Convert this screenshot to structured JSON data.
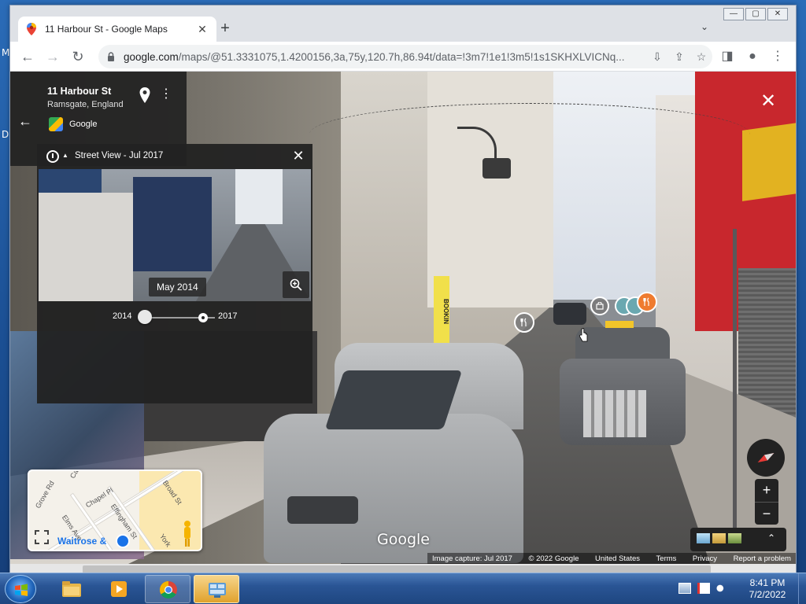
{
  "desktop": {
    "side_letters": [
      "M",
      "D"
    ]
  },
  "browser": {
    "tab": {
      "title": "11 Harbour St - Google Maps"
    },
    "url": {
      "host": "google.com",
      "path": "/maps/@51.3331075,1.4200156,3a,75y,120.7h,86.94t/data=!3m7!1e1!3m5!1s1SKHXLVICNq..."
    }
  },
  "street_view": {
    "place_title": "11 Harbour St",
    "place_subtitle": "Ramsgate, England",
    "provider": "Google",
    "timeline": {
      "header": "Street View - Jul 2017",
      "preview_date": "May 2014",
      "year_start": "2014",
      "year_end": "2017",
      "selected_position": 0.0
    },
    "minimap_labels": {
      "grove_rd": "Grove Rd",
      "elms_ave": "Elms Ave",
      "chapel_pl": "Chapel Pl",
      "effingham_st": "Effingham St",
      "broad_st": "Broad St",
      "york": "York",
      "cat": "Cat",
      "waitrose": "Waitrose &"
    },
    "logo": "Google",
    "scene_text": {
      "booking_sign": "BOOKIN"
    },
    "footer": {
      "capture": "Image capture: Jul 2017",
      "copyright": "© 2022 Google",
      "region": "United States",
      "terms": "Terms",
      "privacy": "Privacy",
      "report": "Report a problem"
    },
    "zoom_in": "+",
    "zoom_out": "−"
  },
  "taskbar": {
    "time": "8:41 PM",
    "date": "7/2/2022"
  },
  "colors": {
    "panel_bg": "#222222",
    "poi_orange": "#ef7b2f",
    "google_blue": "#1a73e8"
  }
}
